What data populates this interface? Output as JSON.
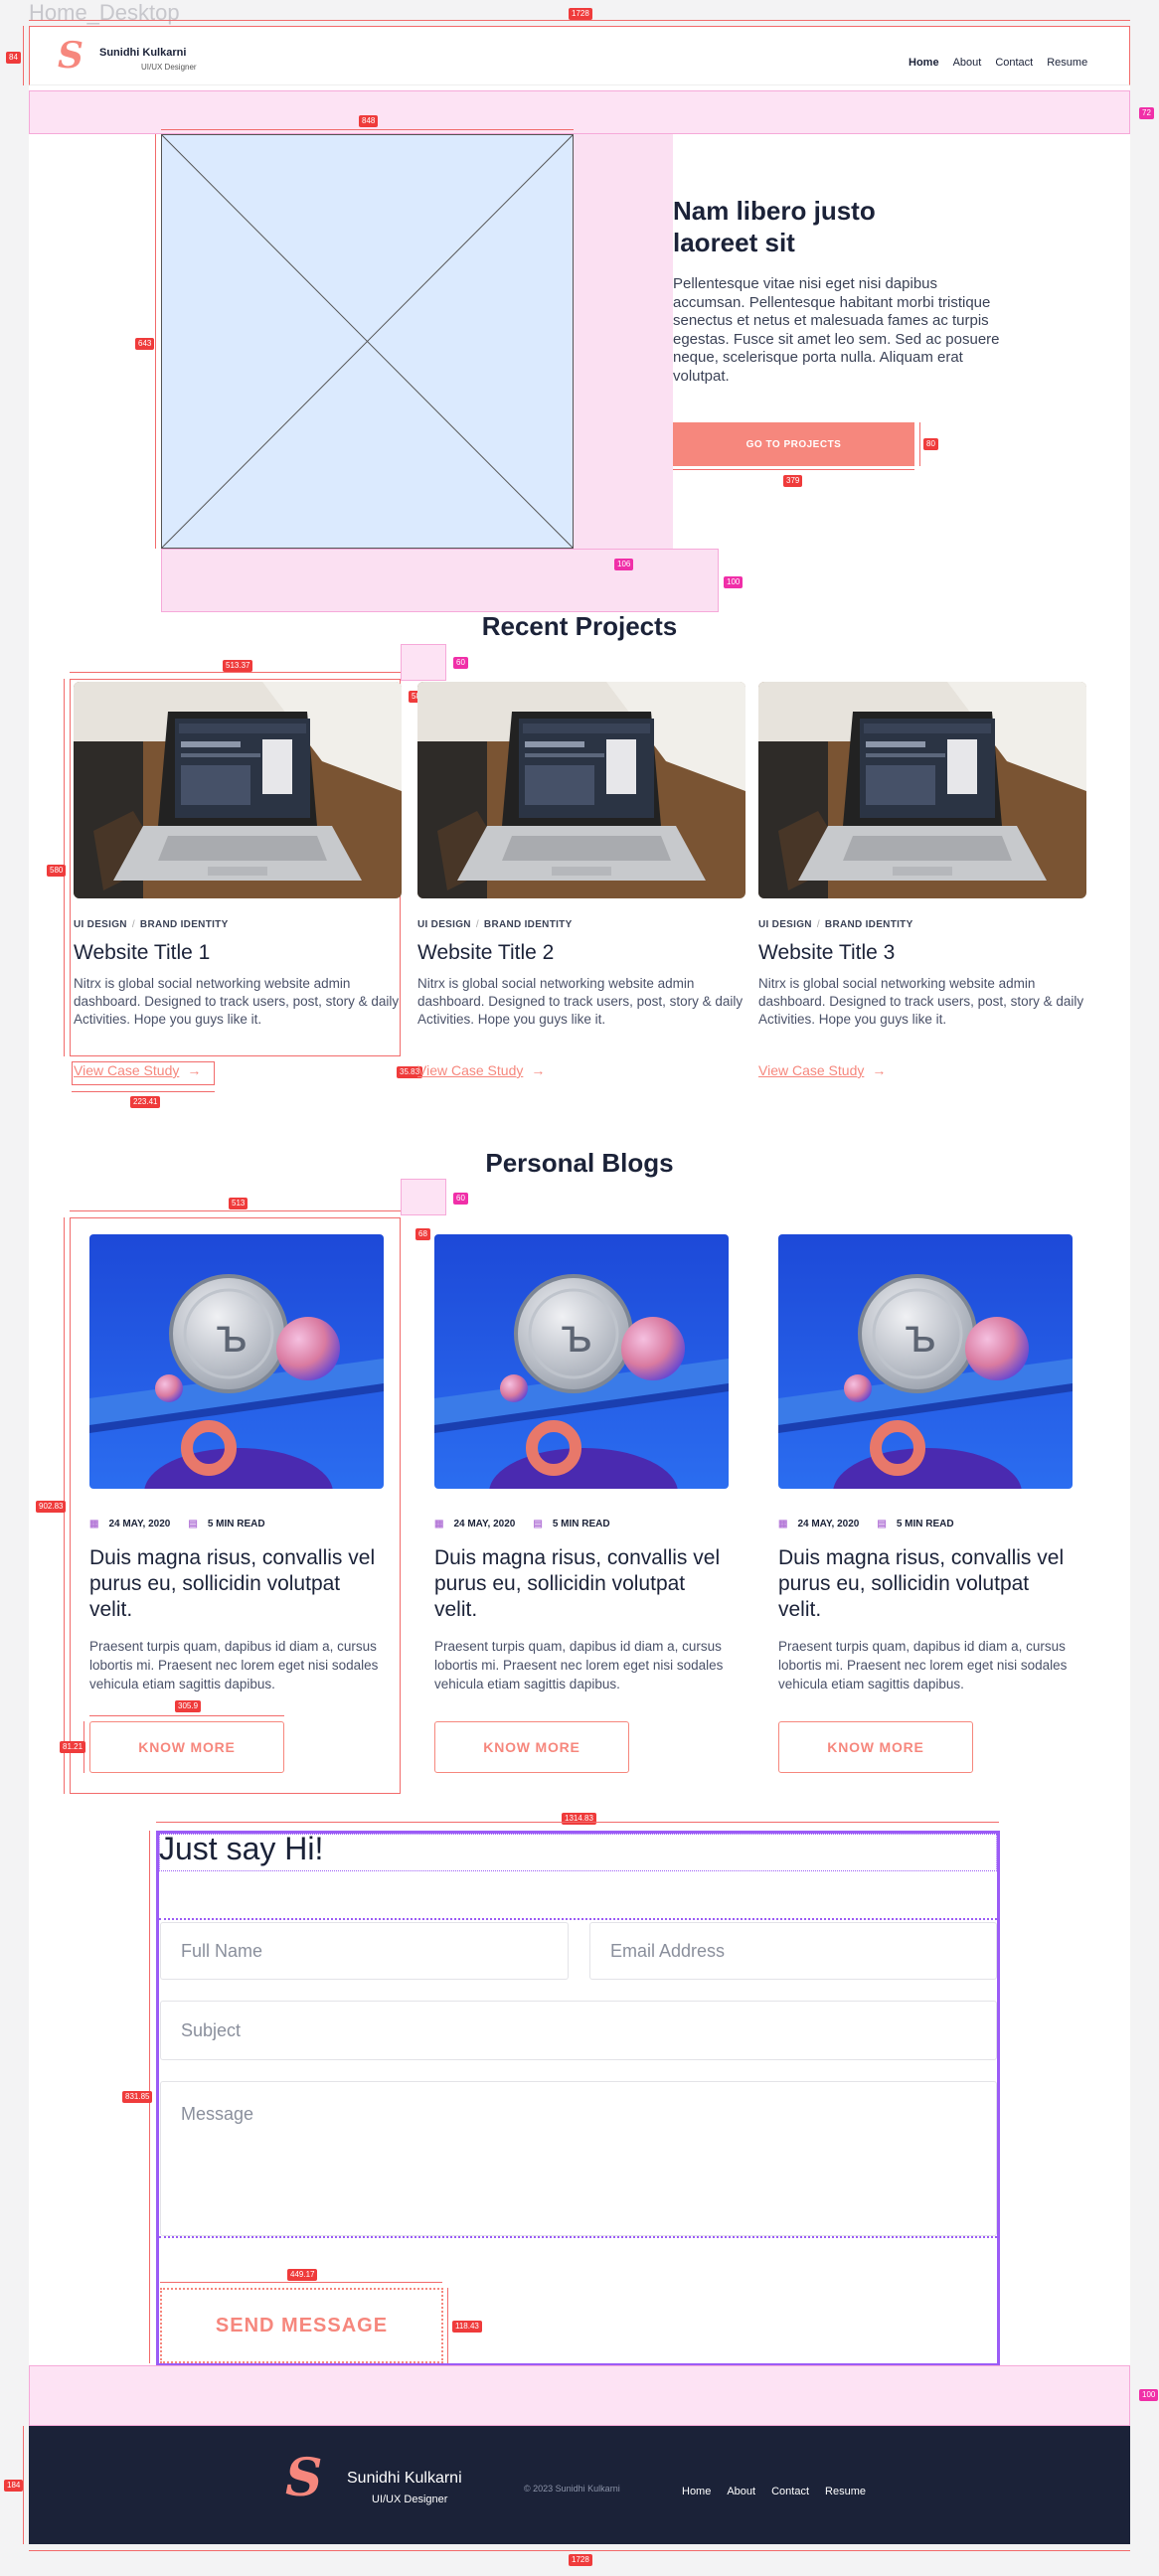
{
  "frame_label": "Home_Desktop",
  "header": {
    "logo_letter": "S",
    "name": "Sunidhi Kulkarni",
    "role": "UI/UX Designer",
    "nav": [
      "Home",
      "About",
      "Contact",
      "Resume"
    ]
  },
  "hero": {
    "title_line1": "Nam libero justo",
    "title_line2": "laoreet sit",
    "text": "Pellentesque vitae nisi eget nisi dapibus accumsan. Pellentesque habitant morbi tristique senectus et netus et malesuada fames ac turpis egestas. Fusce sit amet leo sem. Sed ac posuere neque, scelerisque porta nulla. Aliquam erat volutpat.",
    "button": "GO TO PROJECTS"
  },
  "projects": {
    "heading": "Recent Projects",
    "items": [
      {
        "tag1": "UI DESIGN",
        "tag2": "BRAND IDENTITY",
        "title": "Website Title 1",
        "desc": "Nitrx is global social networking website admin dashboard. Designed to track users, post, story & daily Activities. Hope you guys like it.",
        "link": "View Case Study"
      },
      {
        "tag1": "UI DESIGN",
        "tag2": "BRAND IDENTITY",
        "title": "Website Title 2",
        "desc": "Nitrx is global social networking website admin dashboard. Designed to track users, post, story & daily Activities. Hope you guys like it.",
        "link": "View Case Study"
      },
      {
        "tag1": "UI DESIGN",
        "tag2": "BRAND IDENTITY",
        "title": "Website Title 3",
        "desc": "Nitrx is global social networking website admin dashboard. Designed to track users, post, story & daily Activities. Hope you guys like it.",
        "link": "View Case Study"
      }
    ]
  },
  "blogs": {
    "heading": "Personal Blogs",
    "items": [
      {
        "date": "24 MAY, 2020",
        "read": "5 MIN READ",
        "title": "Duis magna risus, convallis vel purus eu, sollicidin volutpat velit.",
        "desc": "Praesent turpis quam, dapibus id diam a, cursus lobortis mi. Praesent nec lorem eget nisi sodales vehicula etiam sagittis dapibus.",
        "button": "KNOW MORE"
      },
      {
        "date": "24 MAY, 2020",
        "read": "5 MIN READ",
        "title": "Duis magna risus, convallis vel purus eu, sollicidin volutpat velit.",
        "desc": "Praesent turpis quam, dapibus id diam a, cursus lobortis mi. Praesent nec lorem eget nisi sodales vehicula etiam sagittis dapibus.",
        "button": "KNOW MORE"
      },
      {
        "date": "24 MAY, 2020",
        "read": "5 MIN READ",
        "title": "Duis magna risus, convallis vel purus eu, sollicidin volutpat velit.",
        "desc": "Praesent turpis quam, dapibus id diam a, cursus lobortis mi. Praesent nec lorem eget nisi sodales vehicula etiam sagittis dapibus.",
        "button": "KNOW MORE"
      }
    ]
  },
  "contact": {
    "heading": "Just say Hi!",
    "name_placeholder": "Full Name",
    "email_placeholder": "Email Address",
    "subject_placeholder": "Subject",
    "message_placeholder": "Message",
    "button": "SEND MESSAGE"
  },
  "footer": {
    "logo_letter": "S",
    "name": "Sunidhi Kulkarni",
    "role": "UI/UX Designer",
    "copyright": "© 2023 Sunidhi Kulkarni",
    "nav": [
      "Home",
      "About",
      "Contact",
      "Resume"
    ]
  },
  "measurements": {
    "m_1728": "1728",
    "m_84": "84",
    "m_72": "72",
    "m_848": "848",
    "m_643": "643",
    "m_106": "106",
    "m_80": "80",
    "m_379": "379",
    "m_100": "100",
    "m_60": "60",
    "m_51337": "513.37",
    "m_5883": "58.83",
    "m_580": "580",
    "m_3583": "35.83",
    "m_22341": "223.41",
    "m_513": "513",
    "m_68": "68",
    "m_90283": "902.83",
    "m_3059": "305.9",
    "m_8121": "81.21",
    "m_131483": "1314.83",
    "m_83185": "831.85",
    "m_44917": "449.17",
    "m_11843": "118.43",
    "m_100b": "100",
    "m_184": "184",
    "m_1728b": "1728"
  },
  "colors": {
    "accent": "#f6877d",
    "navy": "#1b2238",
    "form_frame": "#9b5cf6",
    "overlay_pink": "#fde3f4"
  }
}
